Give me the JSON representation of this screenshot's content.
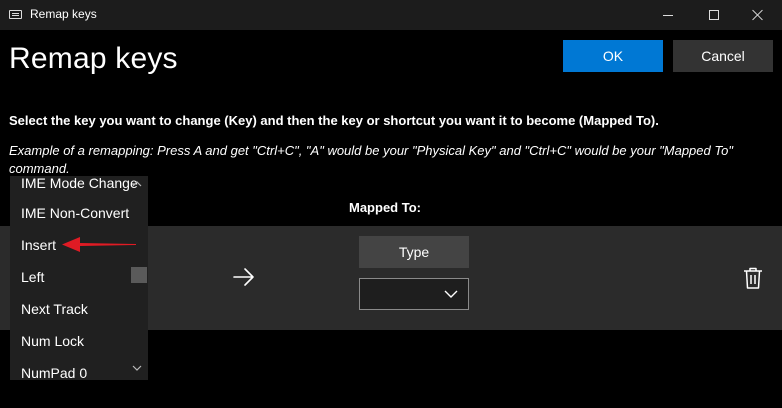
{
  "window": {
    "title": "Remap keys",
    "controls": [
      "minimize",
      "maximize",
      "close"
    ]
  },
  "header": {
    "title": "Remap keys",
    "ok_label": "OK",
    "cancel_label": "Cancel"
  },
  "instructions": {
    "main": "Select the key you want to change (Key) and then the key or shortcut you want it to become (Mapped To).",
    "example": "Example of a remapping: Press A and get \"Ctrl+C\", \"A\" would be your \"Physical Key\" and \"Ctrl+C\" would be your \"Mapped To\" command."
  },
  "columns": {
    "mapped_to": "Mapped To:"
  },
  "mapping": {
    "type_label": "Type",
    "mapped_value": ""
  },
  "dropdown": {
    "items": [
      "IME Mode Change",
      "IME Non-Convert",
      "Insert",
      "Left",
      "Next Track",
      "Num Lock",
      "NumPad 0"
    ],
    "highlighted": "Insert"
  },
  "colors": {
    "accent": "#0078d4",
    "annotation_arrow": "#e01b24",
    "row_background": "#2b2b2b"
  },
  "icons": {
    "arrow": "arrow-right-icon",
    "delete": "trash-icon",
    "dropdown": "chevron-down-icon"
  }
}
